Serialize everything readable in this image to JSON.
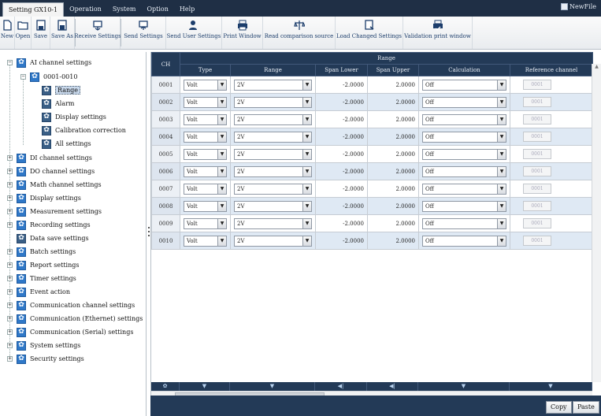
{
  "menu": {
    "tabs": [
      "Setting GX10-1",
      "Operation",
      "System",
      "Option",
      "Help"
    ],
    "newfile": "NewFile"
  },
  "toolbar": {
    "new": "New",
    "open": "Open",
    "save": "Save",
    "save_as": "Save As",
    "receive": "Receive Settings",
    "send": "Send Settings",
    "send_user": "Send User Settings",
    "print": "Print Window",
    "read_comparison": "Read comparison source",
    "load_changed": "Load Changed Settings",
    "validation_print": "Validation print window"
  },
  "tree": {
    "ai": "AI channel settings",
    "group": "0001-0010",
    "range": "Range",
    "alarm": "Alarm",
    "display": "Display settings",
    "calibration": "Calibration correction",
    "all": "All settings",
    "items": [
      "DI channel settings",
      "DO channel settings",
      "Math channel settings",
      "Display settings",
      "Measurement settings",
      "Recording settings",
      "Data save settings",
      "Batch settings",
      "Report settings",
      "Timer settings",
      "Event action",
      "Communication channel settings",
      "Communication (Ethernet) settings",
      "Communication (Serial) settings",
      "System settings",
      "Security settings"
    ]
  },
  "grid": {
    "ch_header": "CH",
    "range_group": "Range",
    "headers": [
      "Type",
      "Range",
      "Span Lower",
      "Span Upper",
      "Calculation",
      "Reference channel"
    ],
    "rows": [
      {
        "ch": "0001",
        "type": "Volt",
        "range": "2V",
        "lower": "-2.0000",
        "upper": "2.0000",
        "calc": "Off",
        "ref": "0001"
      },
      {
        "ch": "0002",
        "type": "Volt",
        "range": "2V",
        "lower": "-2.0000",
        "upper": "2.0000",
        "calc": "Off",
        "ref": "0001"
      },
      {
        "ch": "0003",
        "type": "Volt",
        "range": "2V",
        "lower": "-2.0000",
        "upper": "2.0000",
        "calc": "Off",
        "ref": "0001"
      },
      {
        "ch": "0004",
        "type": "Volt",
        "range": "2V",
        "lower": "-2.0000",
        "upper": "2.0000",
        "calc": "Off",
        "ref": "0001"
      },
      {
        "ch": "0005",
        "type": "Volt",
        "range": "2V",
        "lower": "-2.0000",
        "upper": "2.0000",
        "calc": "Off",
        "ref": "0001"
      },
      {
        "ch": "0006",
        "type": "Volt",
        "range": "2V",
        "lower": "-2.0000",
        "upper": "2.0000",
        "calc": "Off",
        "ref": "0001"
      },
      {
        "ch": "0007",
        "type": "Volt",
        "range": "2V",
        "lower": "-2.0000",
        "upper": "2.0000",
        "calc": "Off",
        "ref": "0001"
      },
      {
        "ch": "0008",
        "type": "Volt",
        "range": "2V",
        "lower": "-2.0000",
        "upper": "2.0000",
        "calc": "Off",
        "ref": "0001"
      },
      {
        "ch": "0009",
        "type": "Volt",
        "range": "2V",
        "lower": "-2.0000",
        "upper": "2.0000",
        "calc": "Off",
        "ref": "0001"
      },
      {
        "ch": "0010",
        "type": "Volt",
        "range": "2V",
        "lower": "-2.0000",
        "upper": "2.0000",
        "calc": "Off",
        "ref": "0001"
      }
    ]
  },
  "bottom": {
    "copy": "Copy",
    "paste": "Paste"
  },
  "colors": {
    "header": "#233a57",
    "alt_row": "#dfe9f4",
    "accent": "#2f78c8"
  }
}
